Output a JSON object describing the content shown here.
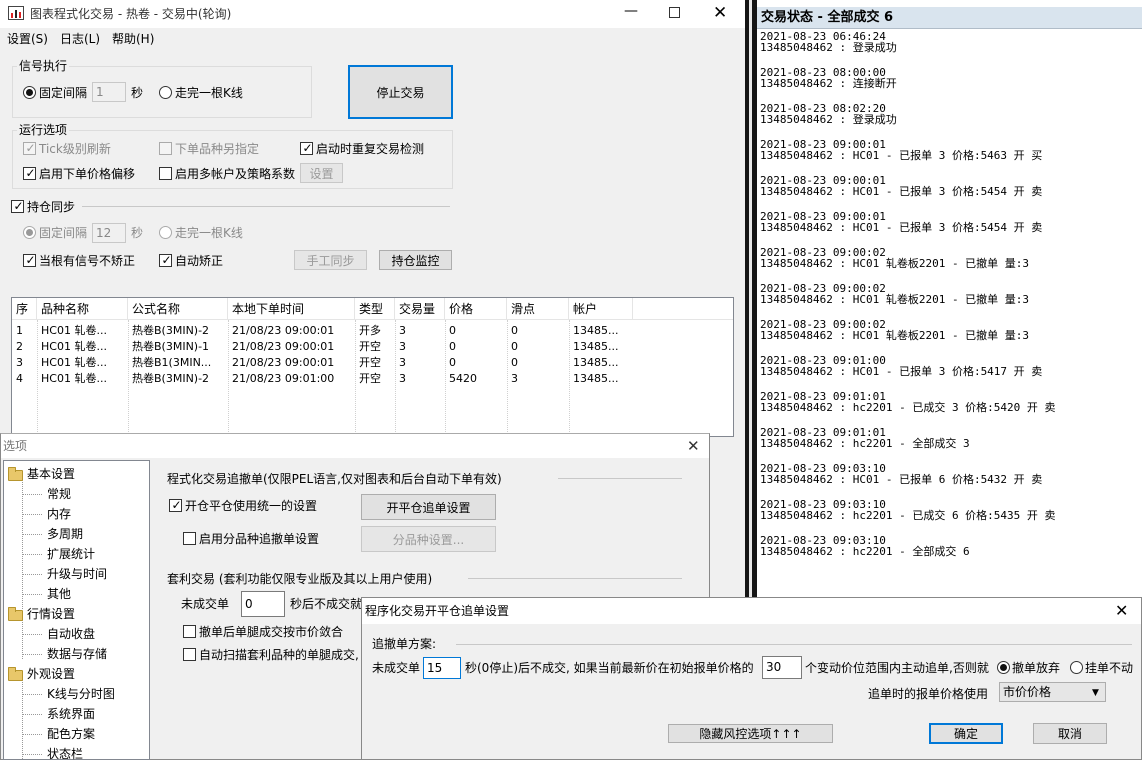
{
  "main": {
    "title": "图表程式化交易 - 热卷 - 交易中(轮询)",
    "menu": [
      "设置(S)",
      "日志(L)",
      "帮助(H)"
    ],
    "signal_group": {
      "title": "信号执行",
      "fixed_interval": "固定间隔",
      "interval_value": "1",
      "seconds": "秒",
      "one_bar": "走完一根K线"
    },
    "stop_button": "停止交易",
    "run_options": {
      "title": "运行选项",
      "tick_refresh": "Tick级别刷新",
      "order_variety": "下单品种另指定",
      "startup_check": "启动时重复交易检测",
      "price_offset": "启用下单价格偏移",
      "multi_account": "启用多帐户及策略系数",
      "settings_button": "设置"
    },
    "position_sync": {
      "title": "持仓同步",
      "fixed_interval": "固定间隔",
      "interval_value": "12",
      "seconds": "秒",
      "one_bar": "走完一根K线",
      "no_correct": "当根有信号不矫正",
      "auto_correct": "自动矫正",
      "manual_sync": "手工同步",
      "monitor": "持仓监控"
    },
    "table": {
      "headers": [
        "序",
        "品种名称",
        "公式名称",
        "本地下单时间",
        "类型",
        "交易量",
        "价格",
        "滑点",
        "帐户"
      ],
      "rows": [
        [
          "1",
          "HC01 轧卷...",
          "热卷B(3MIN)-2",
          "21/08/23 09:00:01",
          "开多",
          "3",
          "0",
          "0",
          "13485..."
        ],
        [
          "2",
          "HC01 轧卷...",
          "热卷B(3MIN)-1",
          "21/08/23 09:00:01",
          "开空",
          "3",
          "0",
          "0",
          "13485..."
        ],
        [
          "3",
          "HC01 轧卷...",
          "热卷B1(3MIN...",
          "21/08/23 09:00:01",
          "开空",
          "3",
          "0",
          "0",
          "13485..."
        ],
        [
          "4",
          "HC01 轧卷...",
          "热卷B(3MIN)-2",
          "21/08/23 09:01:00",
          "开空",
          "3",
          "5420",
          "3",
          "13485..."
        ]
      ]
    }
  },
  "log": {
    "title": "交易状态 - 全部成交 6",
    "entries": [
      {
        "time": "2021-08-23 06:46:24",
        "msg": "13485048462 : 登录成功"
      },
      {
        "time": "2021-08-23 08:00:00",
        "msg": "13485048462 : 连接断开"
      },
      {
        "time": "2021-08-23 08:02:20",
        "msg": "13485048462 : 登录成功"
      },
      {
        "time": "2021-08-23 09:00:01",
        "msg": "13485048462 : HC01 - 已报单 3 价格:5463 开 买"
      },
      {
        "time": "2021-08-23 09:00:01",
        "msg": "13485048462 : HC01 - 已报单 3 价格:5454 开 卖"
      },
      {
        "time": "2021-08-23 09:00:01",
        "msg": "13485048462 : HC01 - 已报单 3 价格:5454 开 卖"
      },
      {
        "time": "2021-08-23 09:00:02",
        "msg": "13485048462 : HC01 轧卷板2201 - 已撤单 量:3"
      },
      {
        "time": "2021-08-23 09:00:02",
        "msg": "13485048462 : HC01 轧卷板2201 - 已撤单 量:3"
      },
      {
        "time": "2021-08-23 09:00:02",
        "msg": "13485048462 : HC01 轧卷板2201 - 已撤单 量:3"
      },
      {
        "time": "2021-08-23 09:01:00",
        "msg": "13485048462 : HC01 - 已报单 3 价格:5417 开 卖"
      },
      {
        "time": "2021-08-23 09:01:01",
        "msg": "13485048462 : hc2201 - 已成交 3 价格:5420 开 卖"
      },
      {
        "time": "2021-08-23 09:01:01",
        "msg": "13485048462 : hc2201 - 全部成交 3"
      },
      {
        "time": "2021-08-23 09:03:10",
        "msg": "13485048462 : HC01 - 已报单 6 价格:5432 开 卖"
      },
      {
        "time": "2021-08-23 09:03:10",
        "msg": "13485048462 : hc2201 - 已成交 6 价格:5435 开 卖"
      },
      {
        "time": "2021-08-23 09:03:10",
        "msg": "13485048462 : hc2201 - 全部成交 6"
      }
    ]
  },
  "options": {
    "title": "选项",
    "tree": [
      {
        "label": "基本设置",
        "kind": "folder"
      },
      {
        "label": "常规",
        "kind": "item"
      },
      {
        "label": "内存",
        "kind": "item"
      },
      {
        "label": "多周期",
        "kind": "item"
      },
      {
        "label": "扩展统计",
        "kind": "item"
      },
      {
        "label": "升级与时间",
        "kind": "item"
      },
      {
        "label": "其他",
        "kind": "item"
      },
      {
        "label": "行情设置",
        "kind": "folder"
      },
      {
        "label": "自动收盘",
        "kind": "item"
      },
      {
        "label": "数据与存储",
        "kind": "item"
      },
      {
        "label": "外观设置",
        "kind": "folder"
      },
      {
        "label": "K线与分时图",
        "kind": "item"
      },
      {
        "label": "系统界面",
        "kind": "item"
      },
      {
        "label": "配色方案",
        "kind": "item"
      },
      {
        "label": "状态栏",
        "kind": "item"
      }
    ],
    "chase_title": "程式化交易追撤单(仅限PEL语言,仅对图表和后台自动下单有效)",
    "unified_label": "开仓平仓使用统一的设置",
    "unified_button": "开平仓追单设置",
    "per_variety_label": "启用分品种追撤单设置",
    "per_variety_button": "分品种设置...",
    "arb_title": "套利交易 (套利功能仅限专业版及其以上用户使用)",
    "unfilled_label": "未成交单",
    "unfilled_value": "0",
    "unfilled_suffix": "秒后不成交就",
    "cancel_leg": "撤单后单腿成交按市价敛合",
    "auto_scan": "自动扫描套利品种的单腿成交,"
  },
  "chase": {
    "title": "程序化交易开平仓追单设置",
    "scheme_label": "追撤单方案:",
    "unfilled_label": "未成交单",
    "seconds_value": "15",
    "mid_text": "秒(0停止)后不成交, 如果当前最新价在初始报单价格的",
    "ticks_value": "30",
    "tail_text": "个变动价位范围内主动追单,否则就",
    "cancel_option": "撤单放弃",
    "hang_option": "挂单不动",
    "price_label": "追单时的报单价格使用",
    "price_value": "市价价格",
    "hide_risk_button": "隐藏风控选项↑↑↑",
    "ok_button": "确定",
    "cancel_button": "取消"
  }
}
